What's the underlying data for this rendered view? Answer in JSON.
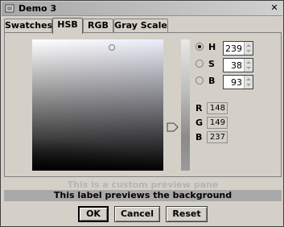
{
  "window": {
    "title": "Demo 3",
    "close_glyph": "✕",
    "icon": "app-icon"
  },
  "tabs": [
    {
      "label": "Swatches",
      "active": false
    },
    {
      "label": "HSB",
      "active": true
    },
    {
      "label": "RGB",
      "active": false
    },
    {
      "label": "Gray Scale",
      "active": false
    }
  ],
  "hsb": {
    "h": {
      "label": "H",
      "value": "239",
      "selected": true
    },
    "s": {
      "label": "S",
      "value": "38",
      "selected": false
    },
    "b": {
      "label": "B",
      "value": "93",
      "selected": false
    }
  },
  "rgb": {
    "r": {
      "label": "R",
      "value": "148"
    },
    "g": {
      "label": "G",
      "value": "149"
    },
    "b": {
      "label": "B",
      "value": "237"
    }
  },
  "preview": {
    "custom_text": "This is a custom preview pane",
    "label_text": "This label previews the background"
  },
  "buttons": {
    "ok": "OK",
    "cancel": "Cancel",
    "reset": "Reset"
  },
  "colors": {
    "preview_background": "#a9a9a9",
    "dialog_background": "#d4d0c8"
  }
}
